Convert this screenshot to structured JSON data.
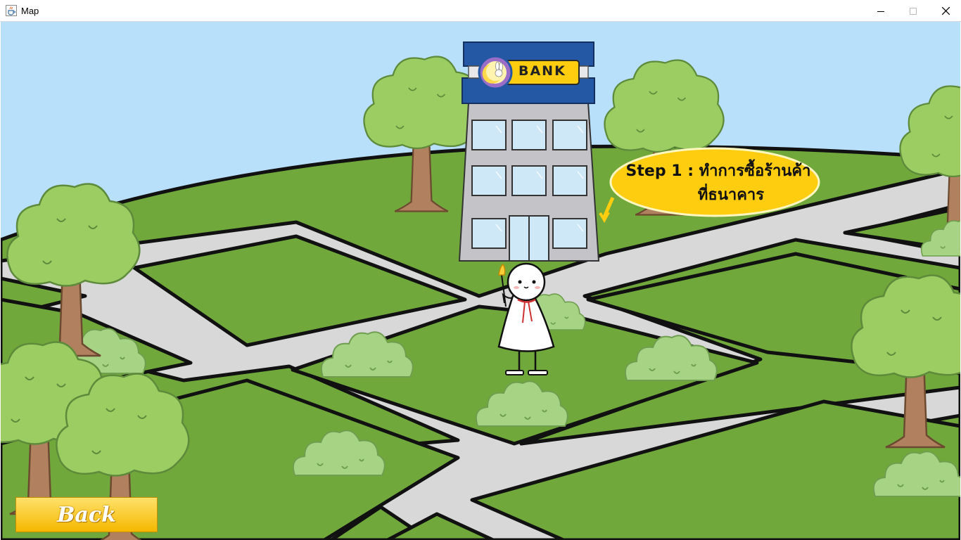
{
  "window": {
    "title": "Map",
    "app_icon": "java-cup-icon",
    "controls": {
      "minimize_icon": "minimize-icon",
      "maximize_icon": "maximize-icon",
      "close_icon": "close-icon"
    }
  },
  "scene": {
    "bank_sign": "BANK",
    "bank_logo_icon": "moon-rabbit-logo-icon",
    "instruction": {
      "step_label": "Step 1 :",
      "line1": "ทำการซื้อร้านค้า",
      "line2": "ที่ธนาคาร"
    },
    "colors": {
      "sky": "#b8e0fb",
      "grass": "#71a83b",
      "road": "#d8d8d8",
      "bubble": "#ffcd0f",
      "tree_leaves": "#9ccd63",
      "trunk": "#b1805e",
      "bank_blue": "#2457a4"
    }
  },
  "back_button": {
    "label": "Back"
  }
}
